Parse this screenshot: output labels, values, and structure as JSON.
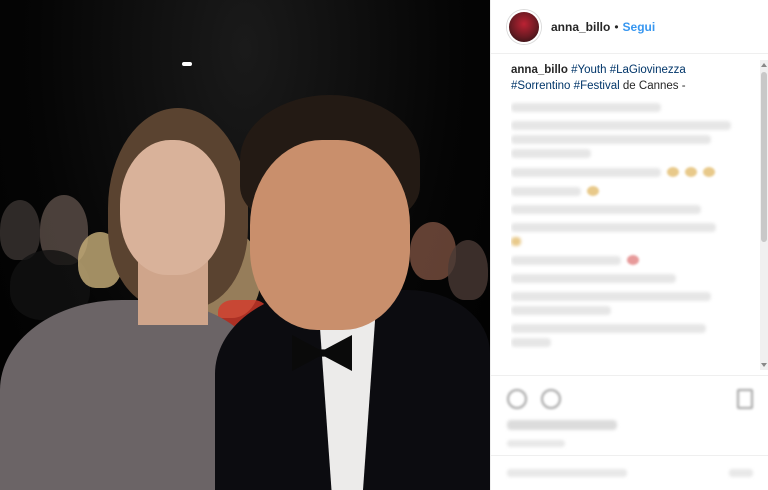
{
  "post": {
    "username": "anna_billo",
    "separator": "•",
    "follow_label": "Segui",
    "caption": {
      "user": "anna_billo",
      "hashtags": [
        "#Youth",
        "#LaGiovinezza",
        "#Sorrentino",
        "#Festival"
      ],
      "tail": "de Cannes -"
    }
  },
  "icons": {
    "avatar": "profile-avatar",
    "like": "heart-icon",
    "comment": "comment-icon",
    "save": "bookmark-icon"
  },
  "colors": {
    "link": "#3897f0",
    "hashtag": "#003569",
    "text": "#262626"
  }
}
